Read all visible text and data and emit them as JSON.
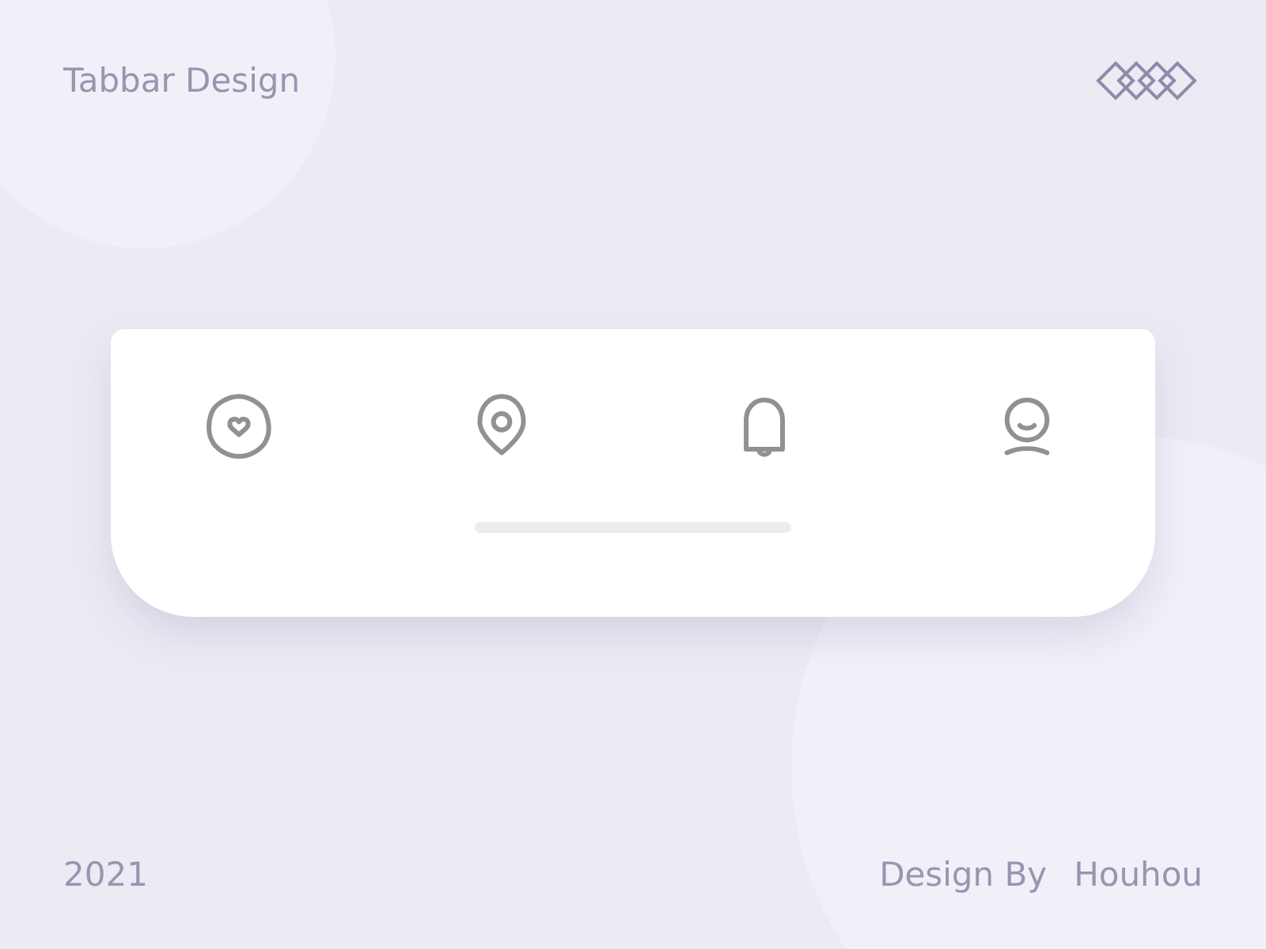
{
  "title": "Tabbar Design",
  "tabs": [
    {
      "kind": "heart"
    },
    {
      "kind": "pin"
    },
    {
      "kind": "bell"
    },
    {
      "kind": "person"
    }
  ],
  "footer": {
    "year": "2021",
    "credit_label": "Design By",
    "author": "Houhou"
  }
}
